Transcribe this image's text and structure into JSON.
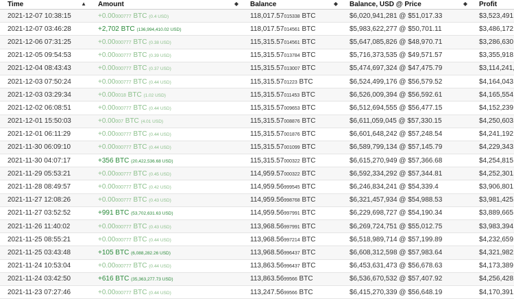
{
  "headers": {
    "time": "Time",
    "amount": "Amount",
    "balance": "Balance",
    "usd": "Balance, USD @ Price",
    "profit": "Profit",
    "sort_icon": "sort-icon"
  },
  "colors": {
    "positive": "#2a8a3a",
    "zero": "#8cc08c",
    "stripe": "#f7f7f7"
  },
  "rows": [
    {
      "time": "2021-12-07 10:38:15",
      "amount_main": "+0.00",
      "amount_small": "000777",
      "amount_unit": " BTC",
      "amount_usd": "(0.4 USD)",
      "balance_main": "118,017.57",
      "balance_small": "015338",
      "balance_unit": " BTC",
      "usd": "$6,020,941,281 @ $51,017.33",
      "profit": "$3,523,491,4",
      "kind": "zero"
    },
    {
      "time": "2021-12-07 03:46:28",
      "amount_main": "+2,702 BTC",
      "amount_small": "",
      "amount_unit": "",
      "amount_usd": "(136,994,410.02 USD)",
      "balance_main": "118,017.57",
      "balance_small": "014561",
      "balance_unit": " BTC",
      "usd": "$5,983,622,277 @ $50,701.11",
      "profit": "$3,486,172,4",
      "kind": "pos"
    },
    {
      "time": "2021-12-06 07:31:25",
      "amount_main": "+0.00",
      "amount_small": "000777",
      "amount_unit": " BTC",
      "amount_usd": "(0.38 USD)",
      "balance_main": "115,315.57",
      "balance_small": "014561",
      "balance_unit": " BTC",
      "usd": "$5,647,085,826 @ $48,970.71",
      "profit": "$3,286,630,2",
      "kind": "zero"
    },
    {
      "time": "2021-12-05 09:54:53",
      "amount_main": "+0.00",
      "amount_small": "000777",
      "amount_unit": " BTC",
      "amount_usd": "(0.39 USD)",
      "balance_main": "115,315.57",
      "balance_small": "013784",
      "balance_unit": " BTC",
      "usd": "$5,716,373,535 @ $49,571.57",
      "profit": "$3,355,918,1",
      "kind": "zero"
    },
    {
      "time": "2021-12-04 08:43:43",
      "amount_main": "+0.00",
      "amount_small": "000777",
      "amount_unit": " BTC",
      "amount_usd": "(0.37 USD)",
      "balance_main": "115,315.57",
      "balance_small": "013007",
      "balance_unit": " BTC",
      "usd": "$5,474,697,324 @ $47,475.79",
      "profit": "$3,114,241,9",
      "kind": "zero"
    },
    {
      "time": "2021-12-03 07:50:24",
      "amount_main": "+0.00",
      "amount_small": "000777",
      "amount_unit": " BTC",
      "amount_usd": "(0.44 USD)",
      "balance_main": "115,315.57",
      "balance_small": "01223",
      "balance_unit": " BTC",
      "usd": "$6,524,499,176 @ $56,579.52",
      "profit": "$4,164,043,7",
      "kind": "zero"
    },
    {
      "time": "2021-12-03 03:29:34",
      "amount_main": "+0.00",
      "amount_small": "0018",
      "amount_unit": " BTC",
      "amount_usd": "(1.02 USD)",
      "balance_main": "115,315.57",
      "balance_small": "011453",
      "balance_unit": " BTC",
      "usd": "$6,526,009,394 @ $56,592.61",
      "profit": "$4,165,554,0",
      "kind": "zero"
    },
    {
      "time": "2021-12-02 06:08:51",
      "amount_main": "+0.00",
      "amount_small": "000777",
      "amount_unit": " BTC",
      "amount_usd": "(0.44 USD)",
      "balance_main": "115,315.57",
      "balance_small": "009653",
      "balance_unit": " BTC",
      "usd": "$6,512,694,555 @ $56,477.15",
      "profit": "$4,152,239,1",
      "kind": "zero"
    },
    {
      "time": "2021-12-01 15:50:03",
      "amount_main": "+0.00",
      "amount_small": "007",
      "amount_unit": " BTC",
      "amount_usd": "(4.01 USD)",
      "balance_main": "115,315.57",
      "balance_small": "008876",
      "balance_unit": " BTC",
      "usd": "$6,611,059,045 @ $57,330.15",
      "profit": "$4,250,603,6",
      "kind": "zero"
    },
    {
      "time": "2021-12-01 06:11:29",
      "amount_main": "+0.00",
      "amount_small": "000777",
      "amount_unit": " BTC",
      "amount_usd": "(0.44 USD)",
      "balance_main": "115,315.57",
      "balance_small": "001876",
      "balance_unit": " BTC",
      "usd": "$6,601,648,242 @ $57,248.54",
      "profit": "$4,241,192,8",
      "kind": "zero"
    },
    {
      "time": "2021-11-30 06:09:10",
      "amount_main": "+0.00",
      "amount_small": "000777",
      "amount_unit": " BTC",
      "amount_usd": "(0.44 USD)",
      "balance_main": "115,315.57",
      "balance_small": "001099",
      "balance_unit": " BTC",
      "usd": "$6,589,799,134 @ $57,145.79",
      "profit": "$4,229,343,7",
      "kind": "zero"
    },
    {
      "time": "2021-11-30 04:07:17",
      "amount_main": "+356 BTC",
      "amount_small": "",
      "amount_unit": "",
      "amount_usd": "(20,422,536.68 USD)",
      "balance_main": "115,315.57",
      "balance_small": "000322",
      "balance_unit": " BTC",
      "usd": "$6,615,270,949 @ $57,366.68",
      "profit": "$4,254,815,5",
      "kind": "pos"
    },
    {
      "time": "2021-11-29 05:53:21",
      "amount_main": "+0.00",
      "amount_small": "000777",
      "amount_unit": " BTC",
      "amount_usd": "(0.45 USD)",
      "balance_main": "114,959.57",
      "balance_small": "000322",
      "balance_unit": " BTC",
      "usd": "$6,592,334,292 @ $57,344.81",
      "profit": "$4,252,301,4",
      "kind": "zero"
    },
    {
      "time": "2021-11-28 08:49:57",
      "amount_main": "+0.00",
      "amount_small": "000777",
      "amount_unit": " BTC",
      "amount_usd": "(0.42 USD)",
      "balance_main": "114,959.56",
      "balance_small": "999545",
      "balance_unit": " BTC",
      "usd": "$6,246,834,241 @ $54,339.4",
      "profit": "$3,906,801,3",
      "kind": "zero"
    },
    {
      "time": "2021-11-27 12:08:26",
      "amount_main": "+0.00",
      "amount_small": "000777",
      "amount_unit": " BTC",
      "amount_usd": "(0.43 USD)",
      "balance_main": "114,959.56",
      "balance_small": "998768",
      "balance_unit": " BTC",
      "usd": "$6,321,457,934 @ $54,988.53",
      "profit": "$3,981,425,0",
      "kind": "zero"
    },
    {
      "time": "2021-11-27 03:52:52",
      "amount_main": "+991 BTC",
      "amount_small": "",
      "amount_unit": "",
      "amount_usd": "(53,702,631.63 USD)",
      "balance_main": "114,959.56",
      "balance_small": "997991",
      "balance_unit": " BTC",
      "usd": "$6,229,698,727 @ $54,190.34",
      "profit": "$3,889,665,8",
      "kind": "pos"
    },
    {
      "time": "2021-11-26 11:40:02",
      "amount_main": "+0.00",
      "amount_small": "000777",
      "amount_unit": " BTC",
      "amount_usd": "(0.43 USD)",
      "balance_main": "113,968.56",
      "balance_small": "997991",
      "balance_unit": " BTC",
      "usd": "$6,269,724,751 @ $55,012.75",
      "profit": "$3,983,394,5",
      "kind": "zero"
    },
    {
      "time": "2021-11-25 08:55:21",
      "amount_main": "+0.00",
      "amount_small": "000777",
      "amount_unit": " BTC",
      "amount_usd": "(0.44 USD)",
      "balance_main": "113,968.56",
      "balance_small": "997214",
      "balance_unit": " BTC",
      "usd": "$6,518,989,714 @ $57,199.89",
      "profit": "$4,232,659,5",
      "kind": "zero"
    },
    {
      "time": "2021-11-25 03:43:48",
      "amount_main": "+105 BTC",
      "amount_small": "",
      "amount_unit": "",
      "amount_usd": "(6,088,282.26 USD)",
      "balance_main": "113,968.56",
      "balance_small": "996437",
      "balance_unit": " BTC",
      "usd": "$6,608,312,598 @ $57,983.64",
      "profit": "$4,321,982,3",
      "kind": "pos"
    },
    {
      "time": "2021-11-24 10:53:04",
      "amount_main": "+0.00",
      "amount_small": "000777",
      "amount_unit": " BTC",
      "amount_usd": "(0.44 USD)",
      "balance_main": "113,863.56",
      "balance_small": "996437",
      "balance_unit": " BTC",
      "usd": "$6,453,631,473 @ $56,678.63",
      "profit": "$4,173,389,5",
      "kind": "zero"
    },
    {
      "time": "2021-11-24 03:42:50",
      "amount_main": "+616 BTC",
      "amount_small": "",
      "amount_unit": "",
      "amount_usd": "(35,363,277.73 USD)",
      "balance_main": "113,863.56",
      "balance_small": "99566",
      "balance_unit": " BTC",
      "usd": "$6,536,670,532 @ $57,407.92",
      "profit": "$4,256,428,6",
      "kind": "pos"
    },
    {
      "time": "2021-11-23 07:27:46",
      "amount_main": "+0.00",
      "amount_small": "000777",
      "amount_unit": " BTC",
      "amount_usd": "(0.44 USD)",
      "balance_main": "113,247.56",
      "balance_small": "99566",
      "balance_unit": " BTC",
      "usd": "$6,415,270,339 @ $56,648.19",
      "profit": "$4,170,391,6",
      "kind": "zero"
    }
  ]
}
